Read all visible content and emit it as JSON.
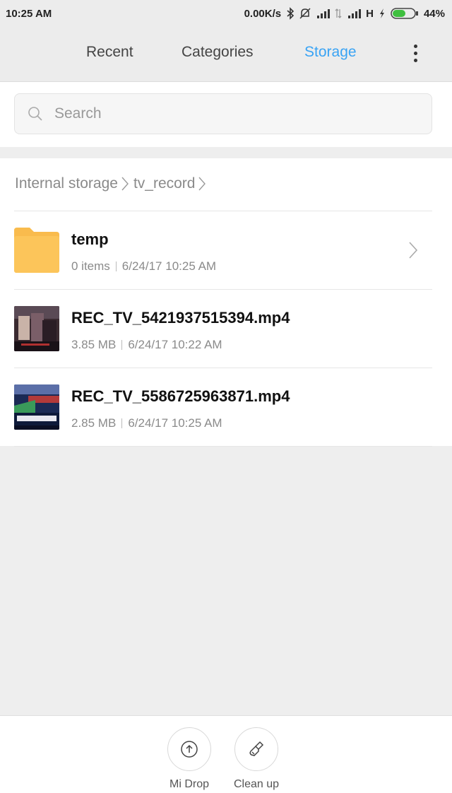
{
  "status_bar": {
    "time": "10:25 AM",
    "net_speed": "0.00K/s",
    "network_type": "H",
    "battery": "44%"
  },
  "tabs": [
    {
      "label": "Recent",
      "active": false
    },
    {
      "label": "Categories",
      "active": false
    },
    {
      "label": "Storage",
      "active": true
    }
  ],
  "search": {
    "placeholder": "Search"
  },
  "breadcrumb": [
    "Internal storage",
    "tv_record"
  ],
  "files": [
    {
      "name": "temp",
      "type": "folder",
      "size": "0 items",
      "date": "6/24/17 10:25 AM",
      "icon": "folder-icon"
    },
    {
      "name": "REC_TV_5421937515394.mp4",
      "type": "video",
      "size": "3.85 MB",
      "date": "6/24/17 10:22 AM",
      "icon": "video-thumbnail"
    },
    {
      "name": "REC_TV_5586725963871.mp4",
      "type": "video",
      "size": "2.85 MB",
      "date": "6/24/17 10:25 AM",
      "icon": "video-thumbnail"
    }
  ],
  "bottom_actions": [
    {
      "label": "Mi Drop",
      "icon": "upload-circle-icon"
    },
    {
      "label": "Clean up",
      "icon": "broom-icon"
    }
  ],
  "colors": {
    "accent": "#39a3f4",
    "folder": "#f9bb4d",
    "battery": "#3fbf3f"
  }
}
